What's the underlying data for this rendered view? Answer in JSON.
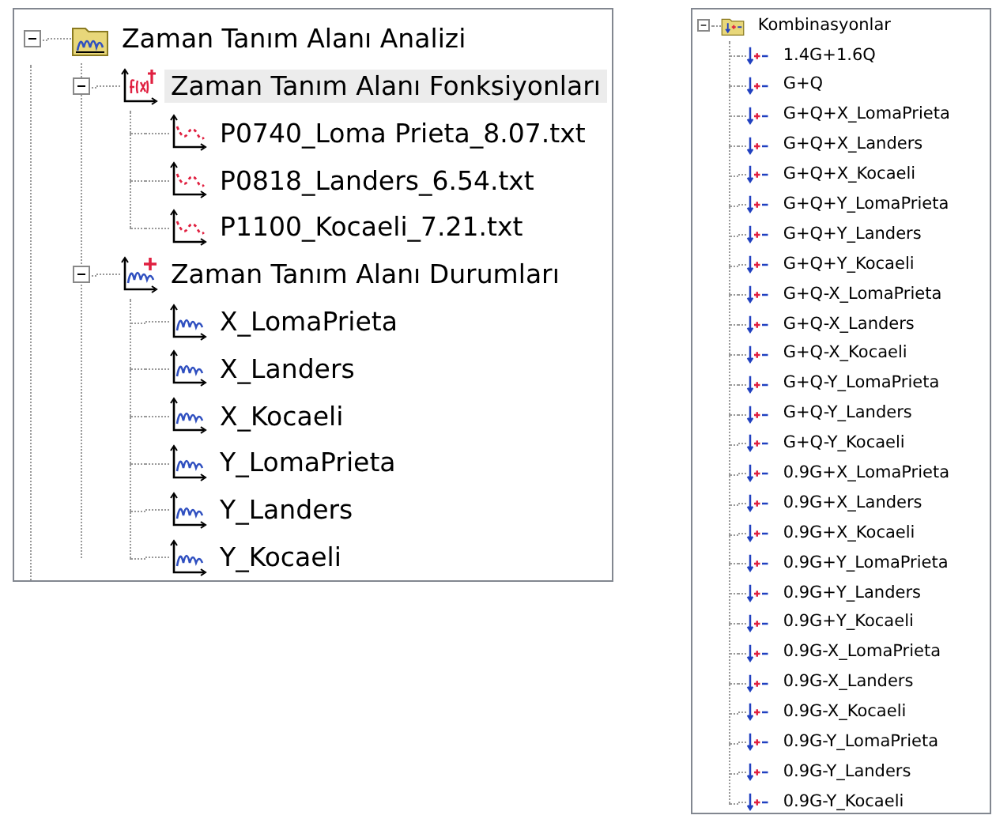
{
  "analysis_tree": [
    {
      "label": "Zaman Tanım Alanı Analizi",
      "kind": "folder",
      "selected": false,
      "expanded": true,
      "children": [
        {
          "label": "Zaman Tanım Alanı Fonksiyonları",
          "kind": "functions",
          "selected": true,
          "expanded": true,
          "children": [
            {
              "label": "P0740_Loma Prieta_8.07.txt",
              "kind": "file",
              "selected": false
            },
            {
              "label": "P0818_Landers_6.54.txt",
              "kind": "file",
              "selected": false
            },
            {
              "label": "P1100_Kocaeli_7.21.txt",
              "kind": "file",
              "selected": false
            }
          ]
        },
        {
          "label": "Zaman Tanım Alanı Durumları",
          "kind": "cases",
          "selected": false,
          "expanded": true,
          "children": [
            {
              "label": "X_LomaPrieta",
              "kind": "case",
              "selected": false
            },
            {
              "label": "X_Landers",
              "kind": "case",
              "selected": false
            },
            {
              "label": "X_Kocaeli",
              "kind": "case",
              "selected": false
            },
            {
              "label": "Y_LomaPrieta",
              "kind": "case",
              "selected": false
            },
            {
              "label": "Y_Landers",
              "kind": "case",
              "selected": false
            },
            {
              "label": "Y_Kocaeli",
              "kind": "case",
              "selected": false
            }
          ]
        }
      ]
    }
  ],
  "combination_tree": [
    {
      "label": "Kombinasyonlar",
      "kind": "combo-folder",
      "selected": false,
      "expanded": true,
      "children": [
        {
          "label": "1.4G+1.6Q",
          "kind": "combo",
          "selected": false
        },
        {
          "label": "G+Q",
          "kind": "combo",
          "selected": false
        },
        {
          "label": "G+Q+X_LomaPrieta",
          "kind": "combo",
          "selected": false
        },
        {
          "label": "G+Q+X_Landers",
          "kind": "combo",
          "selected": false
        },
        {
          "label": "G+Q+X_Kocaeli",
          "kind": "combo",
          "selected": false
        },
        {
          "label": "G+Q+Y_LomaPrieta",
          "kind": "combo",
          "selected": false
        },
        {
          "label": "G+Q+Y_Landers",
          "kind": "combo",
          "selected": false
        },
        {
          "label": "G+Q+Y_Kocaeli",
          "kind": "combo",
          "selected": false
        },
        {
          "label": "G+Q-X_LomaPrieta",
          "kind": "combo",
          "selected": false
        },
        {
          "label": "G+Q-X_Landers",
          "kind": "combo",
          "selected": false
        },
        {
          "label": "G+Q-X_Kocaeli",
          "kind": "combo",
          "selected": false
        },
        {
          "label": "G+Q-Y_LomaPrieta",
          "kind": "combo",
          "selected": false
        },
        {
          "label": "G+Q-Y_Landers",
          "kind": "combo",
          "selected": false
        },
        {
          "label": "G+Q-Y_Kocaeli",
          "kind": "combo",
          "selected": false
        },
        {
          "label": "0.9G+X_LomaPrieta",
          "kind": "combo",
          "selected": false
        },
        {
          "label": "0.9G+X_Landers",
          "kind": "combo",
          "selected": false
        },
        {
          "label": "0.9G+X_Kocaeli",
          "kind": "combo",
          "selected": false
        },
        {
          "label": "0.9G+Y_LomaPrieta",
          "kind": "combo",
          "selected": false
        },
        {
          "label": "0.9G+Y_Landers",
          "kind": "combo",
          "selected": false
        },
        {
          "label": "0.9G+Y_Kocaeli",
          "kind": "combo",
          "selected": false
        },
        {
          "label": "0.9G-X_LomaPrieta",
          "kind": "combo",
          "selected": false
        },
        {
          "label": "0.9G-X_Landers",
          "kind": "combo",
          "selected": false
        },
        {
          "label": "0.9G-X_Kocaeli",
          "kind": "combo",
          "selected": false
        },
        {
          "label": "0.9G-Y_LomaPrieta",
          "kind": "combo",
          "selected": false
        },
        {
          "label": "0.9G-Y_Landers",
          "kind": "combo",
          "selected": false
        },
        {
          "label": "0.9G-Y_Kocaeli",
          "kind": "combo",
          "selected": false
        }
      ]
    }
  ]
}
